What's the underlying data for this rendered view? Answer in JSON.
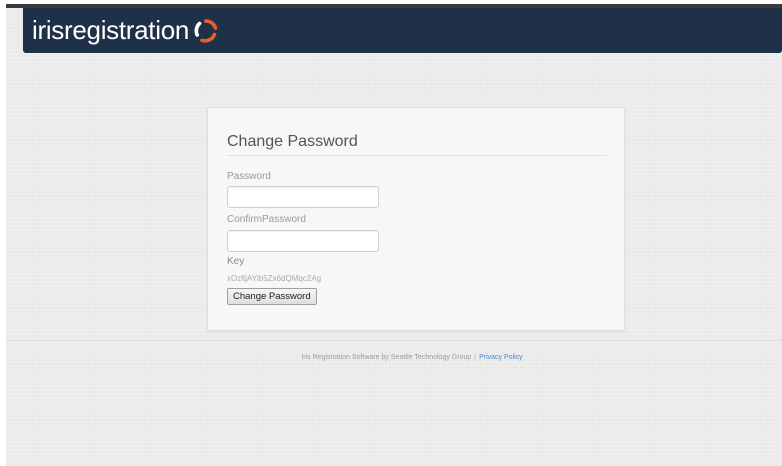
{
  "header": {
    "brand_prefix": "iris",
    "brand_suffix": "registration",
    "logo_icon": "swirl-logo-icon"
  },
  "form": {
    "title": "Change Password",
    "password_label": "Password",
    "password_value": "",
    "confirm_label": "ConfirmPassword",
    "confirm_value": "",
    "key_label": "Key",
    "key_value": "xOzltjAYlb5Zx6dQMqc2Ag",
    "submit_label": "Change Password"
  },
  "footer": {
    "text": "Iris Registration Software by Seattle Technology Group",
    "separator": "|",
    "privacy_link": "Privacy Policy"
  },
  "colors": {
    "header_bg": "#1f3149",
    "logo_accent": "#e8602c",
    "link": "#4a86c5"
  }
}
